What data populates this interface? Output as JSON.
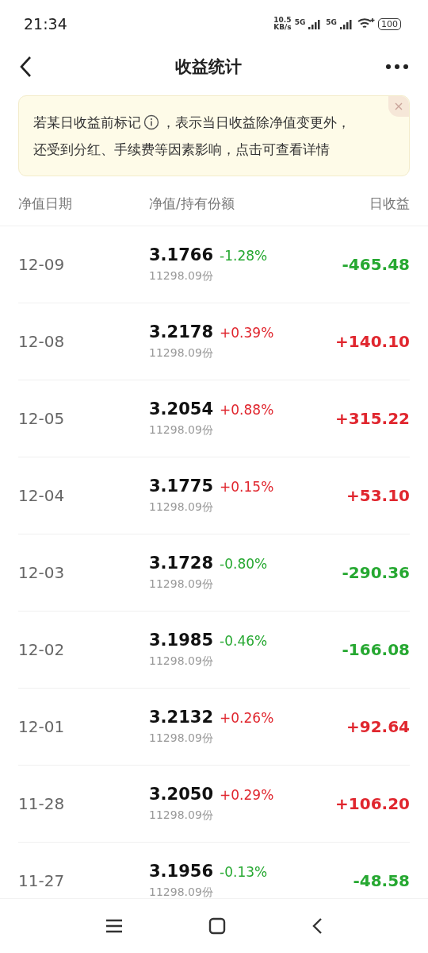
{
  "status_bar": {
    "time": "21:34",
    "speed": "10.5",
    "speed_unit": "KB/s",
    "networks": [
      "5G",
      "5G"
    ],
    "battery": "100"
  },
  "header": {
    "title": "收益统计"
  },
  "notice": {
    "text_before_icon": "若某日收益前标记",
    "text_after_icon": "，表示当日收益除净值变更外，",
    "second_line": "还受到分红、手续费等因素影响，点击可查看详情"
  },
  "table": {
    "columns": [
      "净值日期",
      "净值/持有份额",
      "日收益"
    ],
    "rows": [
      {
        "date": "12-09",
        "nav": "3.1766",
        "change": "-1.28%",
        "shares": "11298.09份",
        "profit": "-465.48",
        "kind": "down"
      },
      {
        "date": "12-08",
        "nav": "3.2178",
        "change": "+0.39%",
        "shares": "11298.09份",
        "profit": "+140.10",
        "kind": "up"
      },
      {
        "date": "12-05",
        "nav": "3.2054",
        "change": "+0.88%",
        "shares": "11298.09份",
        "profit": "+315.22",
        "kind": "up"
      },
      {
        "date": "12-04",
        "nav": "3.1775",
        "change": "+0.15%",
        "shares": "11298.09份",
        "profit": "+53.10",
        "kind": "up"
      },
      {
        "date": "12-03",
        "nav": "3.1728",
        "change": "-0.80%",
        "shares": "11298.09份",
        "profit": "-290.36",
        "kind": "down"
      },
      {
        "date": "12-02",
        "nav": "3.1985",
        "change": "-0.46%",
        "shares": "11298.09份",
        "profit": "-166.08",
        "kind": "down"
      },
      {
        "date": "12-01",
        "nav": "3.2132",
        "change": "+0.26%",
        "shares": "11298.09份",
        "profit": "+92.64",
        "kind": "up"
      },
      {
        "date": "11-28",
        "nav": "3.2050",
        "change": "+0.29%",
        "shares": "11298.09份",
        "profit": "+106.20",
        "kind": "up"
      },
      {
        "date": "11-27",
        "nav": "3.1956",
        "change": "-0.13%",
        "shares": "11298.09份",
        "profit": "-48.58",
        "kind": "down"
      }
    ]
  }
}
